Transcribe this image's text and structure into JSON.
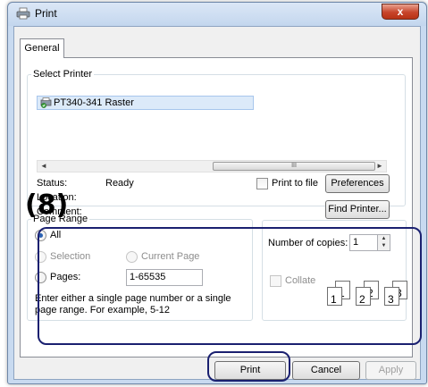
{
  "window": {
    "title": "Print",
    "close_label": "x",
    "tab": "General"
  },
  "select_printer": {
    "legend": "Select Printer",
    "printer_name": "PT340-341 Raster",
    "status_label": "Status:",
    "status_value": "Ready",
    "location_label": "Location:",
    "location_value": "",
    "comment_label": "Comment:",
    "comment_value": "",
    "print_to_file_label": "Print to file",
    "print_to_file_checked": false,
    "preferences_label": "Preferences",
    "find_printer_label": "Find Printer...",
    "scroll_left": "◄",
    "scroll_right": "►",
    "thumb_grip": "III"
  },
  "page_range": {
    "legend": "Page Range",
    "all_label": "All",
    "selection_label": "Selection",
    "current_page_label": "Current Page",
    "pages_label": "Pages:",
    "pages_value": "1-65535",
    "hint": "Enter either a single page number or a single page range.  For example, 5-12",
    "selected": "All"
  },
  "copies": {
    "number_label": "Number of copies:",
    "number_value": "1",
    "collate_label": "Collate",
    "collate_pages": [
      "1",
      "1",
      "2",
      "2",
      "3",
      "3"
    ]
  },
  "buttons": {
    "print": "Print",
    "cancel": "Cancel",
    "apply": "Apply"
  },
  "annotation": {
    "label": "(8)",
    "color": "#1a2070"
  }
}
